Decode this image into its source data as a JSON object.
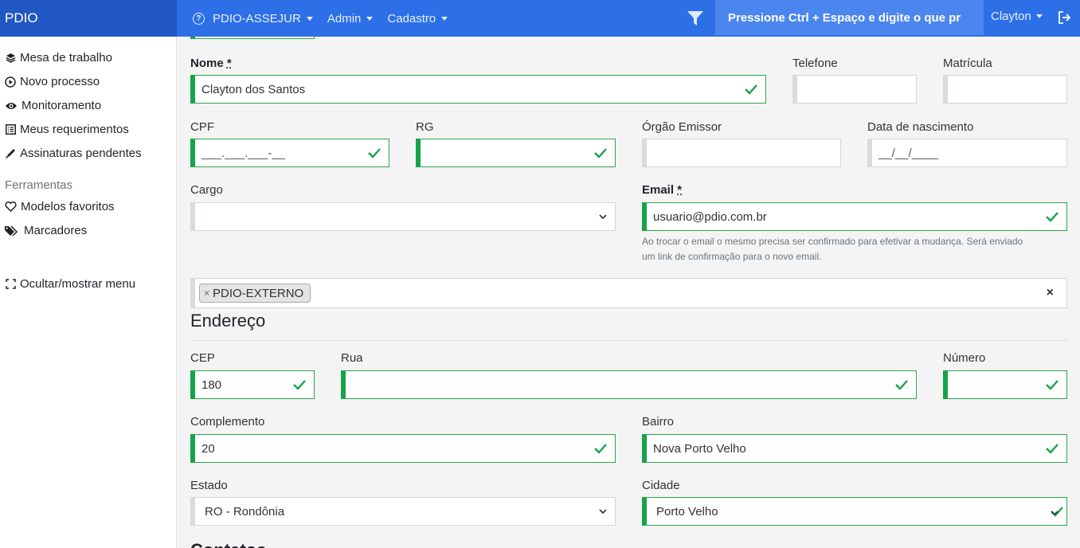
{
  "navbar": {
    "brand": "PDIO",
    "menus": [
      "PDIO-ASSEJUR",
      "Admin",
      "Cadastro"
    ],
    "search_placeholder": "Pressione Ctrl + Espaço e digite o que pr",
    "user": "Clayton"
  },
  "sidebar": {
    "items": [
      "Mesa de trabalho",
      "Novo processo",
      "Monitoramento",
      "Meus requerimentos",
      "Assinaturas pendentes"
    ],
    "tools_heading": "Ferramentas",
    "tools": [
      "Modelos favoritos",
      "Marcadores"
    ],
    "toggle": "Ocultar/mostrar menu"
  },
  "form": {
    "nome_label": "Nome",
    "req_mark": "*",
    "nome_value": "Clayton dos Santos",
    "telefone_label": "Telefone",
    "telefone_value": "",
    "matricula_label": "Matrícula",
    "matricula_value": "",
    "cpf_label": "CPF",
    "cpf_value": "___.___.___-__",
    "rg_label": "RG",
    "rg_value": "",
    "orgao_label": "Órgão Emissor",
    "orgao_value": "",
    "nascimento_label": "Data de nascimento",
    "nascimento_value": "__/__/____",
    "cargo_label": "Cargo",
    "cargo_value": "",
    "email_label": "Email",
    "email_value": "usuario@pdio.com.br",
    "email_help_1": "Ao trocar o email o mesmo precisa ser confirmado para efetivar a mudança. Será enviado",
    "email_help_2": "um link de confirmação para o novo email.",
    "tag_remove": "×",
    "tag": "PDIO-EXTERNO",
    "tag_clear": "×"
  },
  "endereco": {
    "title": "Endereço",
    "cep_label": "CEP",
    "cep_value": "180",
    "rua_label": "Rua",
    "rua_value": "",
    "numero_label": "Número",
    "numero_value": "",
    "complemento_label": "Complemento",
    "complemento_value": "20",
    "bairro_label": "Bairro",
    "bairro_value": "Nova Porto Velho",
    "estado_label": "Estado",
    "estado_value": "RO - Rondônia",
    "cidade_label": "Cidade",
    "cidade_value": "Porto Velho"
  },
  "next_section_partial": "Contatos",
  "colors": {
    "navbar": "#2c6fe6",
    "brand_bg": "#2057c2",
    "valid": "#16a34a",
    "neutral_border": "#d8dbe0"
  }
}
